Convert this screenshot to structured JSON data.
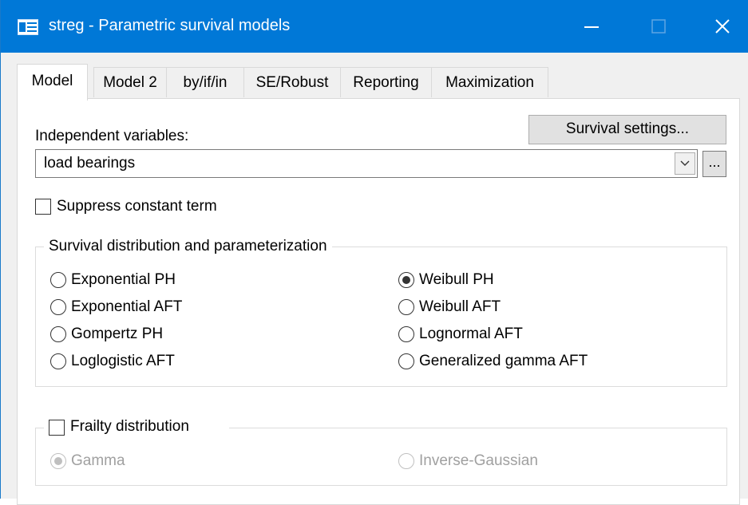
{
  "window": {
    "title": "streg - Parametric survival models",
    "controls": [
      "minimize",
      "maximize",
      "close"
    ]
  },
  "tabs": [
    {
      "label": "Model",
      "active": true
    },
    {
      "label": "Model 2",
      "active": false
    },
    {
      "label": "by/if/in",
      "active": false
    },
    {
      "label": "SE/Robust",
      "active": false
    },
    {
      "label": "Reporting",
      "active": false
    },
    {
      "label": "Maximization",
      "active": false
    }
  ],
  "model": {
    "indep_vars_label": "Independent variables:",
    "survival_settings_button": "Survival settings...",
    "indep_vars_value": "load bearings",
    "ellipsis_button": "...",
    "suppress_constant": {
      "label": "Suppress constant term",
      "checked": false
    },
    "distribution_group": {
      "legend": "Survival distribution and parameterization",
      "left_options": [
        "Exponential PH",
        "Exponential AFT",
        "Gompertz PH",
        "Loglogistic AFT"
      ],
      "right_options": [
        "Weibull PH",
        "Weibull AFT",
        "Lognormal AFT",
        "Generalized gamma AFT"
      ],
      "selected": "Weibull PH"
    },
    "frailty_group": {
      "legend": "Frailty distribution",
      "checked": false,
      "options": [
        "Gamma",
        "Inverse-Gaussian"
      ],
      "selected": "Gamma",
      "enabled": false
    }
  }
}
